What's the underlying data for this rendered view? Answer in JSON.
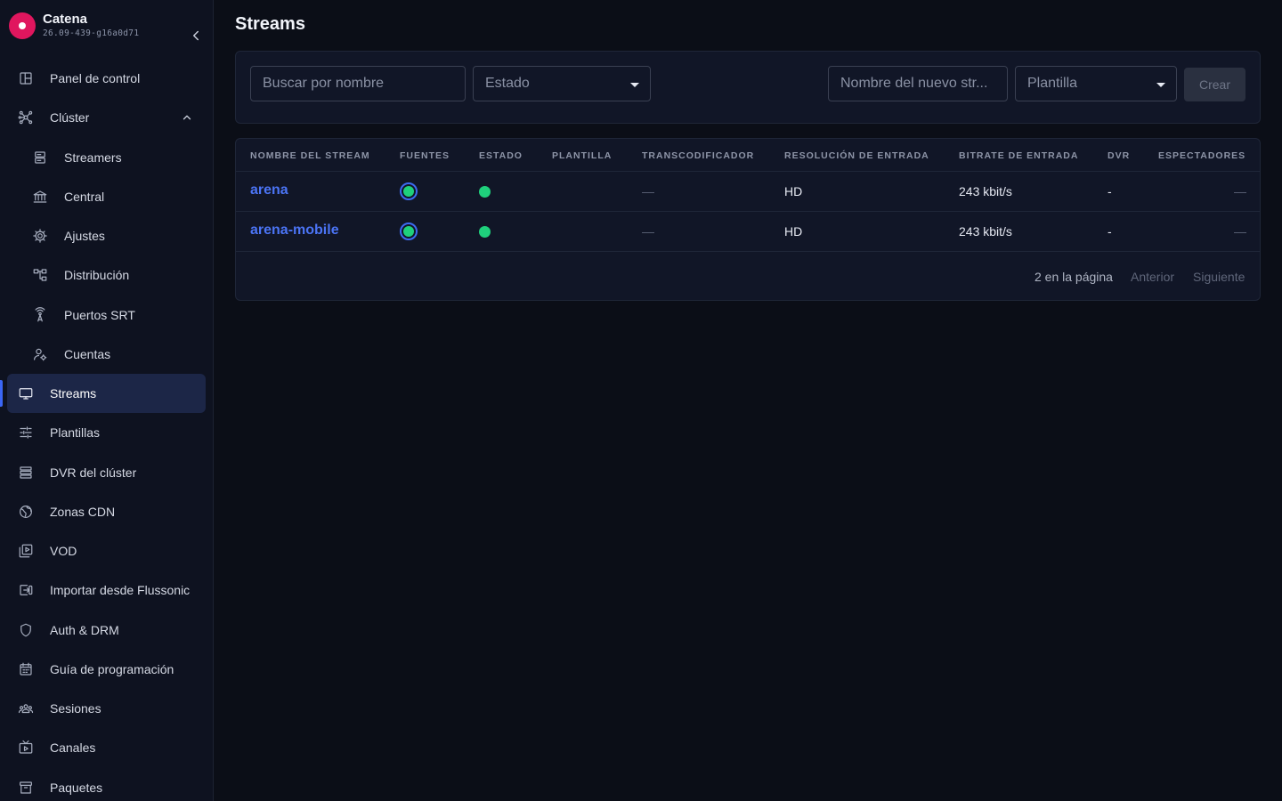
{
  "brand": {
    "name": "Catena",
    "version": "26.09-439-g16a0d71"
  },
  "sidebar": {
    "items": [
      {
        "label": "Panel de control",
        "icon": "dashboard-icon"
      },
      {
        "label": "Clúster",
        "icon": "cluster-icon",
        "expanded": true
      },
      {
        "label": "Streamers",
        "icon": "server-icon"
      },
      {
        "label": "Central",
        "icon": "bank-icon"
      },
      {
        "label": "Ajustes",
        "icon": "gear-icon"
      },
      {
        "label": "Distribución",
        "icon": "distribution-icon"
      },
      {
        "label": "Puertos SRT",
        "icon": "antenna-icon"
      },
      {
        "label": "Cuentas",
        "icon": "users-cog-icon"
      },
      {
        "label": "Streams",
        "icon": "monitor-icon",
        "active": true
      },
      {
        "label": "Plantillas",
        "icon": "sliders-icon"
      },
      {
        "label": "DVR del clúster",
        "icon": "storage-icon"
      },
      {
        "label": "Zonas CDN",
        "icon": "globe-icon"
      },
      {
        "label": "VOD",
        "icon": "video-library-icon"
      },
      {
        "label": "Importar desde Flussonic",
        "icon": "import-icon"
      },
      {
        "label": "Auth & DRM",
        "icon": "shield-icon"
      },
      {
        "label": "Guía de programación",
        "icon": "calendar-icon"
      },
      {
        "label": "Sesiones",
        "icon": "group-icon"
      },
      {
        "label": "Canales",
        "icon": "tv-icon"
      },
      {
        "label": "Paquetes",
        "icon": "archive-icon"
      }
    ]
  },
  "page": {
    "title": "Streams"
  },
  "toolbar": {
    "search_placeholder": "Buscar por nombre",
    "status_select": "Estado",
    "new_stream_placeholder": "Nombre del nuevo str...",
    "template_select": "Plantilla",
    "create_label": "Crear"
  },
  "table": {
    "headers": [
      "NOMBRE DEL STREAM",
      "FUENTES",
      "ESTADO",
      "PLANTILLA",
      "TRANSCODIFICADOR",
      "RESOLUCIÓN DE ENTRADA",
      "BITRATE DE ENTRADA",
      "DVR",
      "ESPECTADORES"
    ],
    "rows": [
      {
        "name": "arena",
        "sources": "online",
        "status": "online",
        "template": "",
        "transcoder": "—",
        "resolution": "HD",
        "bitrate": "243 kbit/s",
        "dvr": "-",
        "viewers": "—"
      },
      {
        "name": "arena-mobile",
        "sources": "online",
        "status": "online",
        "template": "",
        "transcoder": "—",
        "resolution": "HD",
        "bitrate": "243 kbit/s",
        "dvr": "-",
        "viewers": "—"
      }
    ],
    "pagination": {
      "count_text": "2 en la página",
      "prev_label": "Anterior",
      "next_label": "Siguiente"
    }
  },
  "colors": {
    "accent": "#3b66f5",
    "link": "#4b74f5",
    "online": "#1fd07c",
    "brand": "#e0165e",
    "background": "#0b0e17"
  }
}
